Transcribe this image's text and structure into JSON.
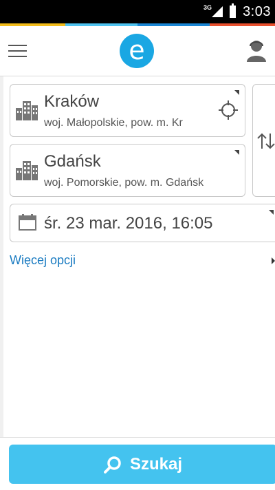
{
  "status_bar": {
    "network": "3G",
    "time": "3:03"
  },
  "colors": {
    "accent": "#1aa7e3",
    "button": "#44c3ef",
    "link": "#1a7bc1",
    "strip": [
      "#f2bc1b",
      "#4fc3f0",
      "#1a86d4",
      "#e8502e"
    ]
  },
  "header": {
    "logo_letter": "e",
    "menu_icon": "hamburger-icon",
    "user_icon": "user-icon"
  },
  "from": {
    "city": "Kraków",
    "region": "woj. Małopolskie, pow. m. Kr",
    "icon": "building-icon",
    "action_icon": "locate-icon"
  },
  "to": {
    "city": "Gdańsk",
    "region": "woj. Pomorskie, pow. m. Gdańsk",
    "icon": "building-icon"
  },
  "swap_icon": "swap-icon",
  "date": {
    "value": "śr. 23 mar. 2016, 16:05",
    "icon": "calendar-icon"
  },
  "more_options": {
    "label": "Więcej opcji"
  },
  "search": {
    "label": "Szukaj",
    "icon": "search-icon"
  }
}
